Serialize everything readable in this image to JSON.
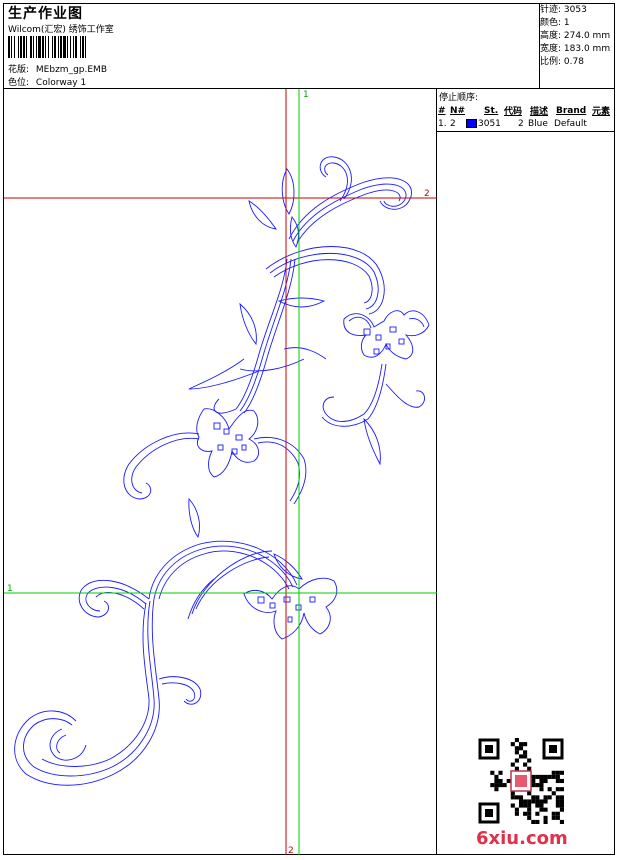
{
  "header": {
    "title": "生产作业图",
    "company": "Wilcom(汇宏) 绣饰工作室",
    "design_label": "花版:",
    "design_file": "MEbzm_gp.EMB",
    "colorway_label": "色位:",
    "colorway": "Colorway 1"
  },
  "stats": {
    "stitches_label": "针迹:",
    "stitches": "3053",
    "colors_label": "颜色:",
    "colors": "1",
    "height_label": "高度:",
    "height": "274.0 mm",
    "width_label": "宽度:",
    "width": "183.0 mm",
    "scale_label": "比例:",
    "scale": "0.78"
  },
  "stop_sequence": {
    "title": "停止顺序:",
    "columns": [
      "#",
      "N#",
      "St.",
      "代码",
      "描述",
      "Brand",
      "元素"
    ],
    "rows": [
      {
        "index": "1.",
        "needle": "2",
        "stitches": "3051",
        "code": "2",
        "description": "Blue",
        "brand": "Default",
        "swatch_color": "#0000ff"
      }
    ]
  },
  "canvas": {
    "red_axis_label_top": "2",
    "red_axis_label_bottom": "2",
    "green_axis_label_top": "1",
    "green_axis_label_left": "1",
    "red_color": "#cc0000",
    "green_color": "#00cc00",
    "stitch_color": "#1a1aff"
  },
  "watermark": {
    "text": "6xiu.com"
  }
}
